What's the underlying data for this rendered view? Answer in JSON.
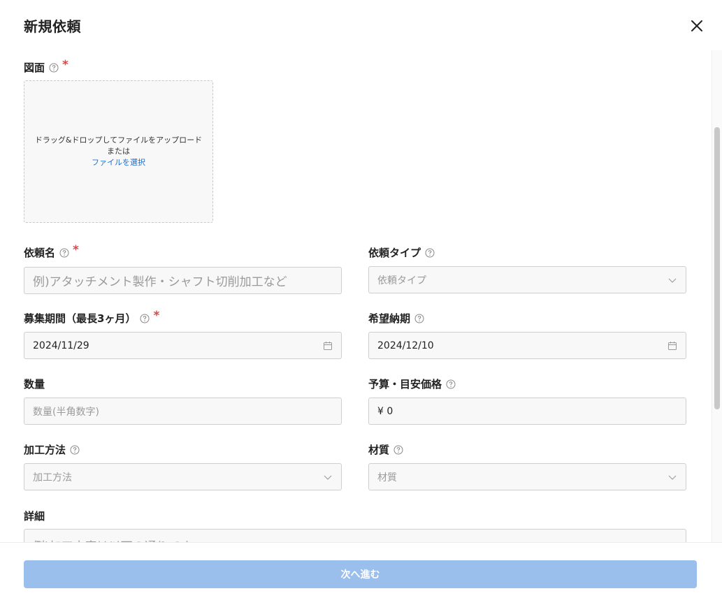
{
  "modal": {
    "title": "新規依頼",
    "close_icon": "close-icon"
  },
  "form": {
    "drawing": {
      "label": "図面",
      "required": "*",
      "dropzone_text": "ドラッグ&ドロップしてファイルをアップロード",
      "or_text": "または",
      "select_link": "ファイルを選択"
    },
    "request_name": {
      "label": "依頼名",
      "required": "*",
      "placeholder": "例)アタッチメント製作・シャフト切削加工など"
    },
    "request_type": {
      "label": "依頼タイプ",
      "placeholder": "依頼タイプ"
    },
    "recruit_period": {
      "label": "募集期間（最長3ヶ月）",
      "required": "*",
      "value": "2024/11/29"
    },
    "desired_delivery": {
      "label": "希望納期",
      "value": "2024/12/10"
    },
    "quantity": {
      "label": "数量",
      "placeholder": "数量(半角数字)"
    },
    "budget": {
      "label": "予算・目安価格",
      "value": "¥ 0"
    },
    "processing_method": {
      "label": "加工方法",
      "placeholder": "加工方法"
    },
    "material": {
      "label": "材質",
      "placeholder": "材質"
    },
    "details": {
      "label": "詳細",
      "placeholder": "例)加工内容は以下の通りです。"
    }
  },
  "footer": {
    "next_label": "次へ進む"
  },
  "colors": {
    "required": "#e04545",
    "link": "#1a6fd1",
    "primary_disabled": "#9bbfec"
  }
}
